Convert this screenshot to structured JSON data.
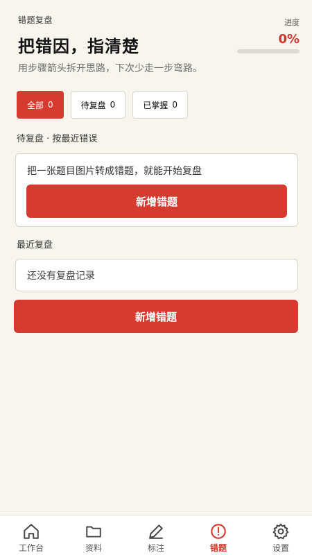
{
  "header": {
    "eyebrow": "错题复盘",
    "title": "把错因，指清楚",
    "subtitle": "用步骤箭头拆开思路，下次少走一步弯路。",
    "progress_label": "进度",
    "progress_value": "0%",
    "progress_fraction": 0
  },
  "filters": [
    {
      "label": "全部",
      "count": "0",
      "active": true
    },
    {
      "label": "待复盘",
      "count": "0",
      "active": false
    },
    {
      "label": "已掌握",
      "count": "0",
      "active": false
    }
  ],
  "pending": {
    "label": "待复盘 · 按最近错误",
    "empty_text": "把一张题目图片转成错题，就能开始复盘",
    "button_label": "新增错题"
  },
  "recent": {
    "label": "最近复盘",
    "empty_text": "还没有复盘记录"
  },
  "main_button_label": "新增错题",
  "tabbar": {
    "items": [
      {
        "label": "工作台",
        "icon": "home-icon",
        "active": false
      },
      {
        "label": "资料",
        "icon": "folder-icon",
        "active": false
      },
      {
        "label": "标注",
        "icon": "pencil-icon",
        "active": false
      },
      {
        "label": "错题",
        "icon": "alert-circle-icon",
        "active": true
      },
      {
        "label": "设置",
        "icon": "gear-icon",
        "active": false
      }
    ]
  },
  "colors": {
    "accent": "#d63b30",
    "background": "#f8f5ed"
  }
}
